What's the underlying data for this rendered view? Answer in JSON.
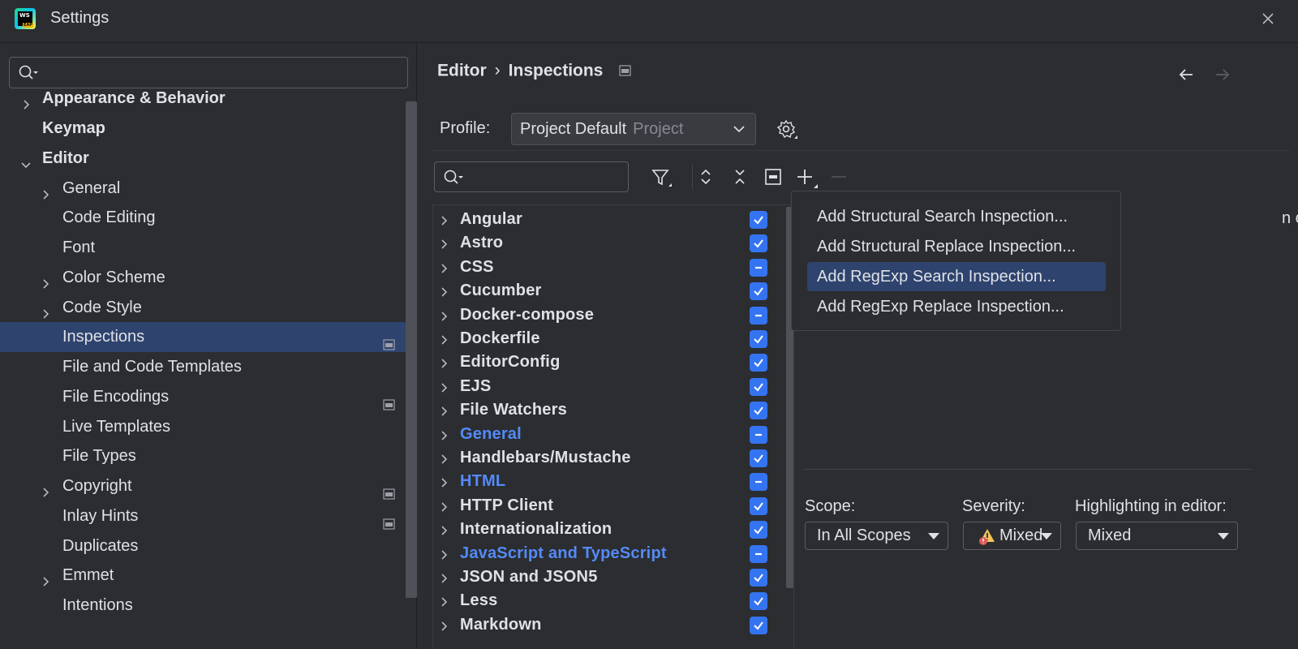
{
  "window": {
    "title": "Settings",
    "logo_text": "WS",
    "logo_badge": "EAP"
  },
  "sidebar": {
    "search_placeholder": "",
    "items": [
      {
        "label": "Appearance & Behavior",
        "level": 0,
        "expandable": true,
        "expanded": false,
        "bold": true,
        "project_icon": false,
        "selected": false
      },
      {
        "label": "Keymap",
        "level": 0,
        "expandable": false,
        "expanded": false,
        "bold": true,
        "project_icon": false,
        "selected": false
      },
      {
        "label": "Editor",
        "level": 0,
        "expandable": true,
        "expanded": true,
        "bold": true,
        "project_icon": false,
        "selected": false
      },
      {
        "label": "General",
        "level": 1,
        "expandable": true,
        "expanded": false,
        "bold": false,
        "project_icon": false,
        "selected": false
      },
      {
        "label": "Code Editing",
        "level": 1,
        "expandable": false,
        "expanded": false,
        "bold": false,
        "project_icon": false,
        "selected": false
      },
      {
        "label": "Font",
        "level": 1,
        "expandable": false,
        "expanded": false,
        "bold": false,
        "project_icon": false,
        "selected": false
      },
      {
        "label": "Color Scheme",
        "level": 1,
        "expandable": true,
        "expanded": false,
        "bold": false,
        "project_icon": false,
        "selected": false
      },
      {
        "label": "Code Style",
        "level": 1,
        "expandable": true,
        "expanded": false,
        "bold": false,
        "project_icon": false,
        "selected": false
      },
      {
        "label": "Inspections",
        "level": 1,
        "expandable": false,
        "expanded": false,
        "bold": false,
        "project_icon": true,
        "selected": true
      },
      {
        "label": "File and Code Templates",
        "level": 1,
        "expandable": false,
        "expanded": false,
        "bold": false,
        "project_icon": false,
        "selected": false
      },
      {
        "label": "File Encodings",
        "level": 1,
        "expandable": false,
        "expanded": false,
        "bold": false,
        "project_icon": true,
        "selected": false
      },
      {
        "label": "Live Templates",
        "level": 1,
        "expandable": false,
        "expanded": false,
        "bold": false,
        "project_icon": false,
        "selected": false
      },
      {
        "label": "File Types",
        "level": 1,
        "expandable": false,
        "expanded": false,
        "bold": false,
        "project_icon": false,
        "selected": false
      },
      {
        "label": "Copyright",
        "level": 1,
        "expandable": true,
        "expanded": false,
        "bold": false,
        "project_icon": true,
        "selected": false
      },
      {
        "label": "Inlay Hints",
        "level": 1,
        "expandable": false,
        "expanded": false,
        "bold": false,
        "project_icon": true,
        "selected": false
      },
      {
        "label": "Duplicates",
        "level": 1,
        "expandable": false,
        "expanded": false,
        "bold": false,
        "project_icon": false,
        "selected": false
      },
      {
        "label": "Emmet",
        "level": 1,
        "expandable": true,
        "expanded": false,
        "bold": false,
        "project_icon": false,
        "selected": false
      },
      {
        "label": "Intentions",
        "level": 1,
        "expandable": false,
        "expanded": false,
        "bold": false,
        "project_icon": false,
        "selected": false
      }
    ]
  },
  "breadcrumb": {
    "parent": "Editor",
    "current": "Inspections"
  },
  "profile": {
    "label": "Profile:",
    "value": "Project Default",
    "scope_hint": "Project"
  },
  "inspection_search": {
    "placeholder": ""
  },
  "inspections": [
    {
      "label": "Angular",
      "state": "checked",
      "modified": false
    },
    {
      "label": "Astro",
      "state": "checked",
      "modified": false
    },
    {
      "label": "CSS",
      "state": "mixed",
      "modified": false
    },
    {
      "label": "Cucumber",
      "state": "checked",
      "modified": false
    },
    {
      "label": "Docker-compose",
      "state": "mixed",
      "modified": false
    },
    {
      "label": "Dockerfile",
      "state": "checked",
      "modified": false
    },
    {
      "label": "EditorConfig",
      "state": "checked",
      "modified": false
    },
    {
      "label": "EJS",
      "state": "checked",
      "modified": false
    },
    {
      "label": "File Watchers",
      "state": "checked",
      "modified": false
    },
    {
      "label": "General",
      "state": "mixed",
      "modified": true
    },
    {
      "label": "Handlebars/Mustache",
      "state": "checked",
      "modified": false
    },
    {
      "label": "HTML",
      "state": "mixed",
      "modified": true
    },
    {
      "label": "HTTP Client",
      "state": "checked",
      "modified": false
    },
    {
      "label": "Internationalization",
      "state": "checked",
      "modified": false
    },
    {
      "label": "JavaScript and TypeScript",
      "state": "mixed",
      "modified": true
    },
    {
      "label": "JSON and JSON5",
      "state": "checked",
      "modified": false
    },
    {
      "label": "Less",
      "state": "checked",
      "modified": false
    },
    {
      "label": "Markdown",
      "state": "checked",
      "modified": false
    }
  ],
  "description_fragment": "n edit them as a",
  "add_menu": {
    "items": [
      {
        "label": "Add Structural Search Inspection...",
        "selected": false
      },
      {
        "label": "Add Structural Replace Inspection...",
        "selected": false
      },
      {
        "label": "Add RegExp Search Inspection...",
        "selected": true
      },
      {
        "label": "Add RegExp Replace Inspection...",
        "selected": false
      }
    ]
  },
  "options": {
    "scope_label": "Scope:",
    "scope_value": "In All Scopes",
    "severity_label": "Severity:",
    "severity_value": "Mixed",
    "highlighting_label": "Highlighting in editor:",
    "highlighting_value": "Mixed"
  },
  "colors": {
    "background": "#2b2d30",
    "selection": "#2e436e",
    "checkbox": "#3574f0",
    "modified_text": "#548af7",
    "text": "#dfe1e5"
  }
}
